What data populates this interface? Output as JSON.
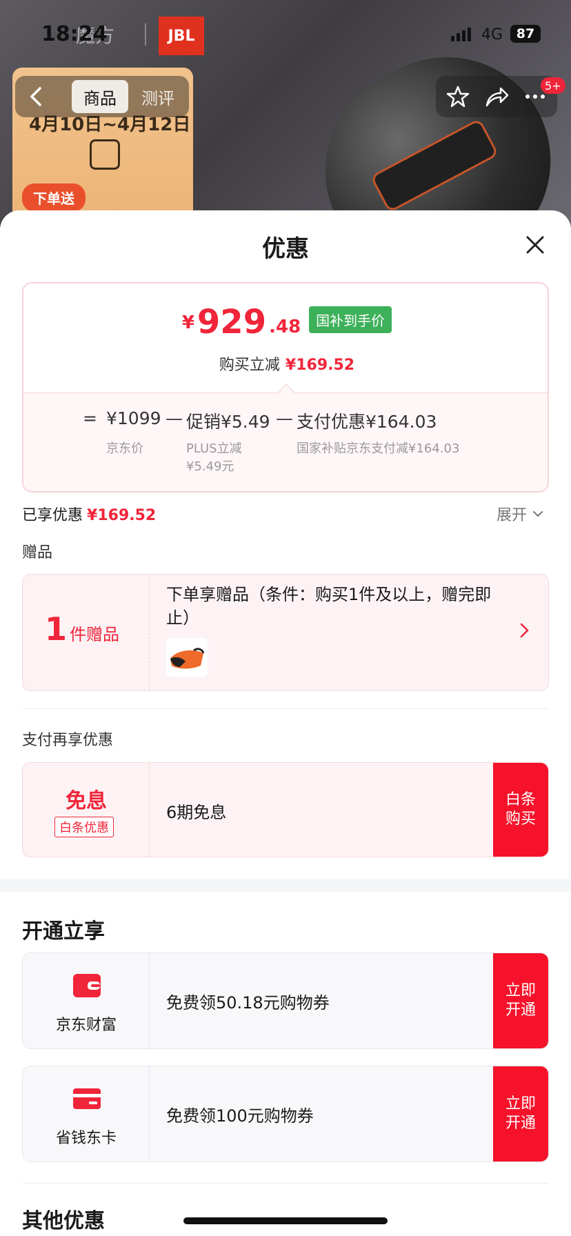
{
  "status_bar": {
    "time": "18:24",
    "network": "4G",
    "battery": "87"
  },
  "header": {
    "brand_text": "魔方",
    "jbl": "JBL",
    "promo_dates": "4月10日~4月12日",
    "promo_tag": "下单送",
    "tabs": [
      {
        "label": "商品"
      },
      {
        "label": "测评"
      }
    ],
    "badge": "5+"
  },
  "sheet": {
    "title": "优惠",
    "price": {
      "currency": "¥",
      "integer": "929",
      "decimal": ".48",
      "tag": "国补到手价",
      "reduce_label": "购买立减",
      "reduce_value": "¥169.52"
    },
    "calculation": {
      "eq": "=",
      "base_value": "¥1099",
      "base_label": "京东价",
      "minus1": "—",
      "promo_value": "促销¥5.49",
      "promo_label_1": "PLUS立减",
      "promo_label_2": "¥5.49元",
      "minus2": "—",
      "pay_value": "支付优惠¥164.03",
      "pay_label": "国家补贴京东支付减¥164.03"
    },
    "enjoyed_label": "已享优惠",
    "enjoyed_value": "¥169.52",
    "expand_label": "展开",
    "gift_section": "赠品",
    "gift": {
      "count": "1",
      "count_unit": "件赠品",
      "description": "下单享赠品（条件：购买1件及以上，赠完即止）"
    },
    "pay_section": "支付再享优惠",
    "interest": {
      "title": "免息",
      "badge": "白条优惠",
      "description": "6期免息",
      "button": "白条购买"
    },
    "open_section": "开通立享",
    "members": [
      {
        "name": "京东财富",
        "description": "免费领50.18元购物券",
        "button": "立即开通",
        "icon": "wallet-icon"
      },
      {
        "name": "省钱东卡",
        "description": "免费领100元购物券",
        "button": "立即开通",
        "icon": "card-icon"
      }
    ],
    "other_section": "其他优惠"
  },
  "colors": {
    "accent": "#f0253a",
    "button": "#f5122a",
    "national_tag": "#3db05a"
  }
}
